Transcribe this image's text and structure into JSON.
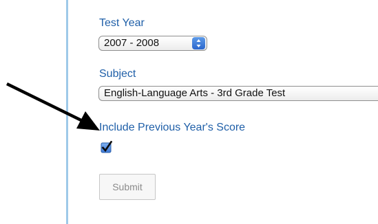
{
  "form": {
    "test_year": {
      "label": "Test Year",
      "selected": "2007 - 2008"
    },
    "subject": {
      "label": "Subject",
      "selected": "English-Language Arts - 3rd Grade Test"
    },
    "include_previous": {
      "label": "Include Previous Year's Score",
      "checked": true
    },
    "submit_label": "Submit"
  },
  "annotation": {
    "arrow_icon": "arrow-pointing-icon",
    "arrow_color": "#000000"
  },
  "colors": {
    "label": "#1f5fa8",
    "left_rule": "#9ec9e9",
    "stepper": "#2a66cd"
  }
}
